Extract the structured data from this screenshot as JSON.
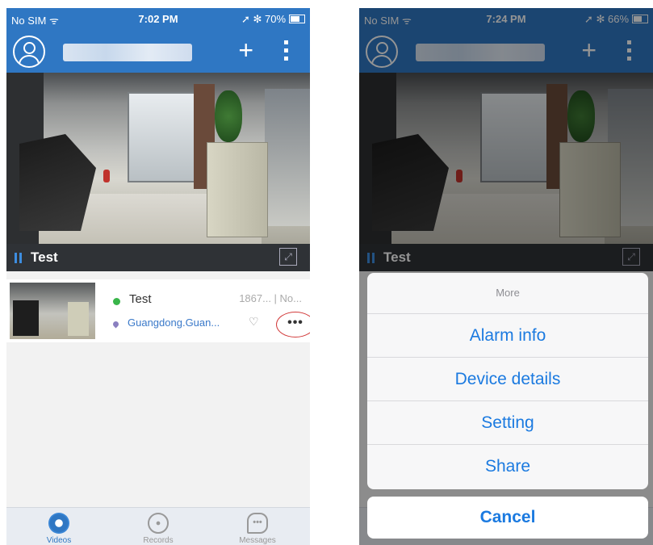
{
  "left": {
    "status": {
      "carrier": "No SIM ᯤ",
      "time": "7:02 PM",
      "right": "➚ ✻ 70%"
    },
    "camera_label": "Test",
    "device": {
      "name": "Test",
      "info": "1867... | No...",
      "location": "Guangdong.Guan...",
      "more": "•••"
    },
    "tabs": [
      {
        "label": "Videos"
      },
      {
        "label": "Records"
      },
      {
        "label": "Messages"
      }
    ]
  },
  "right": {
    "status": {
      "carrier": "No SIM ᯤ",
      "time": "7:24 PM",
      "right": "➚ ✻ 66%"
    },
    "camera_label": "Test",
    "sheet": {
      "title": "More",
      "options": [
        "Alarm info",
        "Device details",
        "Setting",
        "Share"
      ],
      "cancel": "Cancel"
    }
  },
  "colors": {
    "brand": "#2f77c3",
    "action": "#1b7ae0",
    "online": "#39b54a"
  }
}
